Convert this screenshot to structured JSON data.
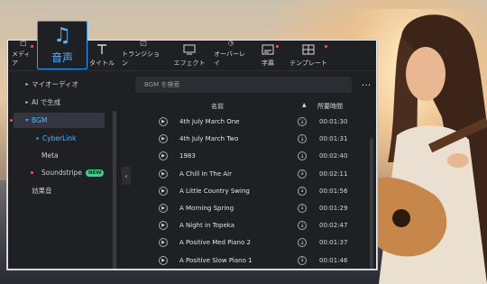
{
  "toolbar": {
    "items": [
      {
        "label": "メディア",
        "icon": "media-icon",
        "badge": true
      },
      {
        "label": "タイトル",
        "icon": "title-icon",
        "badge": false
      },
      {
        "label": "トランジション",
        "icon": "transition-icon",
        "badge": false
      },
      {
        "label": "エフェクト",
        "icon": "effect-icon",
        "badge": false
      },
      {
        "label": "オーバーレイ",
        "icon": "overlay-icon",
        "badge": false
      },
      {
        "label": "字幕",
        "icon": "subtitle-icon",
        "badge": true
      },
      {
        "label": "テンプレート",
        "icon": "template-icon",
        "badge": true
      }
    ],
    "active": {
      "label": "音声",
      "icon": "music-note-icon"
    }
  },
  "sidebar": {
    "items": [
      {
        "label": "マイオーディオ",
        "expanded": false
      },
      {
        "label": "AI で生成",
        "expanded": false
      },
      {
        "label": "BGM",
        "expanded": true,
        "selected": true
      },
      {
        "label": "CyberLink",
        "expanded": false,
        "child": true
      },
      {
        "label": "Meta",
        "child": true
      },
      {
        "label": "Soundstripe",
        "child": true,
        "badge": "NEW"
      },
      {
        "label": "効果音"
      }
    ]
  },
  "search": {
    "placeholder": "BGM を検索"
  },
  "table": {
    "columns": {
      "name": "名前",
      "duration": "所要時間"
    },
    "rows": [
      {
        "title": "4th July March One",
        "duration": "00:01:30"
      },
      {
        "title": "4th July March Two",
        "duration": "00:01:31"
      },
      {
        "title": "1983",
        "duration": "00:02:40"
      },
      {
        "title": "A Chill In The Air",
        "duration": "00:02:11"
      },
      {
        "title": "A Little Country Swing",
        "duration": "00:01:56"
      },
      {
        "title": "A Morning Spring",
        "duration": "00:01:29"
      },
      {
        "title": "A Night in Topeka",
        "duration": "00:02:47"
      },
      {
        "title": "A Positive Med Piano 2",
        "duration": "00:01:37"
      },
      {
        "title": "A Positive Slow Piano 1",
        "duration": "00:01:46"
      }
    ]
  },
  "colors": {
    "accent": "#2e9bff",
    "badge_new": "#3ad18b",
    "dot": "#ff4d6a",
    "panel": "#1f2024"
  }
}
